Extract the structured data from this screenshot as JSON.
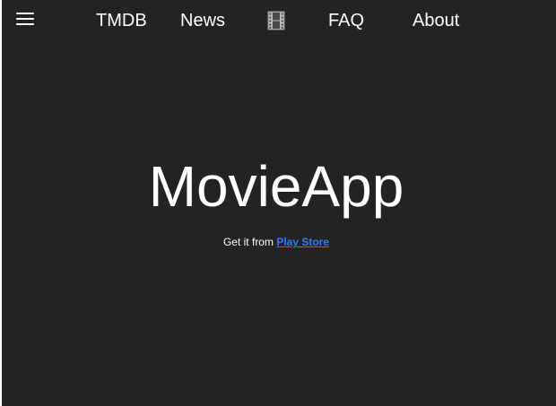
{
  "nav": {
    "menu_icon": "hamburger-menu-icon",
    "film_icon": "film-strip-icon",
    "links": [
      "TMDB",
      "News",
      "FAQ",
      "About"
    ]
  },
  "hero": {
    "title": "MovieApp",
    "subtitle_prefix": "Get it from ",
    "store_link": "Play Store"
  },
  "colors": {
    "background": "#232323",
    "text": "#ffffff",
    "link": "#2f7df5"
  }
}
